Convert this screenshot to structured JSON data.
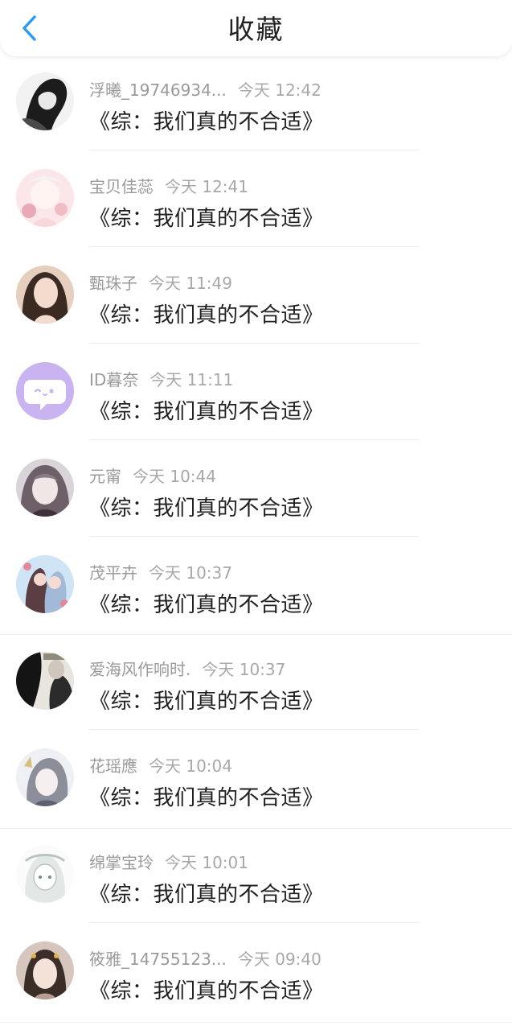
{
  "header": {
    "title": "收藏",
    "back_icon": "chevron-left-icon",
    "accent": "#2b9af3"
  },
  "items": [
    {
      "name": "浮曦_19746934...",
      "time": "今天 12:42",
      "quote": "《综：我们真的不合适》",
      "avatar_colors": [
        "#f2f2f2",
        "#1c1c1c"
      ]
    },
    {
      "name": "宝贝佳蕊",
      "time": "今天 12:41",
      "quote": "《综：我们真的不合适》",
      "avatar_colors": [
        "#fbe6ea",
        "#e9a9b6"
      ]
    },
    {
      "name": "甄珠子",
      "time": "今天 11:49",
      "quote": "《综：我们真的不合适》",
      "avatar_colors": [
        "#e6cfbf",
        "#3a2a22"
      ]
    },
    {
      "name": "ID暮奈",
      "time": "今天 11:11",
      "quote": "《综：我们真的不合适》",
      "avatar_colors": [
        "#c9b3f0",
        "#ffffff"
      ]
    },
    {
      "name": "元甯",
      "time": "今天 10:44",
      "quote": "《综：我们真的不合适》",
      "avatar_colors": [
        "#d9d4d8",
        "#6d6068"
      ]
    },
    {
      "name": "茂平卉",
      "time": "今天 10:37",
      "quote": "《综：我们真的不合适》",
      "avatar_colors": [
        "#cfe4f4",
        "#5b3e44"
      ]
    },
    {
      "name": "爱海风作响时.",
      "time": "今天 10:37",
      "quote": "《综：我们真的不合适》",
      "avatar_colors": [
        "#e8e4de",
        "#141414"
      ]
    },
    {
      "name": "花瑶應",
      "time": "今天 10:04",
      "quote": "《综：我们真的不合适》",
      "avatar_colors": [
        "#eef0f4",
        "#8c8f9a"
      ]
    },
    {
      "name": "绵掌宝玲",
      "time": "今天 10:01",
      "quote": "《综：我们真的不合适》",
      "avatar_colors": [
        "#fbfbfb",
        "#b9c4bf"
      ]
    },
    {
      "name": "筱雅_14755123...",
      "time": "今天 09:40",
      "quote": "《综：我们真的不合适》",
      "avatar_colors": [
        "#d7c6bd",
        "#3b2d28"
      ]
    }
  ]
}
